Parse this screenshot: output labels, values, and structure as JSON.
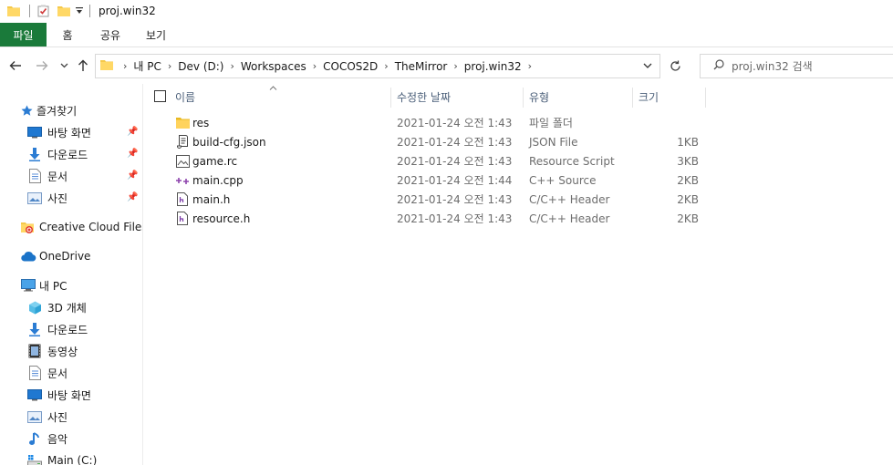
{
  "window": {
    "title": "proj.win32"
  },
  "quick_access": {
    "icons": [
      "folder-icon",
      "properties-checkbox-icon",
      "new-folder-icon",
      "customize-dropdown-icon"
    ]
  },
  "ribbon": {
    "tabs": [
      {
        "label": "파일"
      },
      {
        "label": "홈"
      },
      {
        "label": "공유"
      },
      {
        "label": "보기"
      }
    ],
    "file_tab_color": "#1a7a3a"
  },
  "navigation": {
    "back": "←",
    "forward": "→",
    "recent": "⌄",
    "up": "↑"
  },
  "address": {
    "breadcrumbs": [
      {
        "label": "내 PC"
      },
      {
        "label": "Dev (D:)"
      },
      {
        "label": "Workspaces"
      },
      {
        "label": "COCOS2D"
      },
      {
        "label": "TheMirror"
      },
      {
        "label": "proj.win32"
      }
    ]
  },
  "search": {
    "placeholder": "proj.win32 검색"
  },
  "nav_pane": {
    "quick_access_label": "즐겨찾기",
    "pinned": [
      {
        "label": "바탕 화면",
        "icon": "desktop-icon"
      },
      {
        "label": "다운로드",
        "icon": "downloads-icon"
      },
      {
        "label": "문서",
        "icon": "documents-icon"
      },
      {
        "label": "사진",
        "icon": "pictures-icon"
      }
    ],
    "creative_cloud": "Creative Cloud Files",
    "onedrive": "OneDrive",
    "this_pc": "내 PC",
    "pc_items": [
      {
        "label": "3D 개체",
        "icon": "3d-objects-icon"
      },
      {
        "label": "다운로드",
        "icon": "downloads-icon"
      },
      {
        "label": "동영상",
        "icon": "videos-icon"
      },
      {
        "label": "문서",
        "icon": "documents-icon"
      },
      {
        "label": "바탕 화면",
        "icon": "desktop-icon"
      },
      {
        "label": "사진",
        "icon": "pictures-icon"
      },
      {
        "label": "음악",
        "icon": "music-icon"
      },
      {
        "label": "Main (C:)",
        "icon": "drive-icon"
      }
    ]
  },
  "columns": {
    "name": "이름",
    "date": "수정한 날짜",
    "type": "유형",
    "size": "크기"
  },
  "files": [
    {
      "name": "res",
      "date": "2021-01-24 오전 1:43",
      "type": "파일 폴더",
      "size": "",
      "icon": "folder-icon"
    },
    {
      "name": "build-cfg.json",
      "date": "2021-01-24 오전 1:43",
      "type": "JSON File",
      "size": "1KB",
      "icon": "json-file-icon"
    },
    {
      "name": "game.rc",
      "date": "2021-01-24 오전 1:43",
      "type": "Resource Script",
      "size": "3KB",
      "icon": "resource-file-icon"
    },
    {
      "name": "main.cpp",
      "date": "2021-01-24 오전 1:44",
      "type": "C++ Source",
      "size": "2KB",
      "icon": "cpp-file-icon"
    },
    {
      "name": "main.h",
      "date": "2021-01-24 오전 1:43",
      "type": "C/C++ Header",
      "size": "2KB",
      "icon": "header-file-icon"
    },
    {
      "name": "resource.h",
      "date": "2021-01-24 오전 1:43",
      "type": "C/C++ Header",
      "size": "2KB",
      "icon": "header-file-icon"
    }
  ]
}
